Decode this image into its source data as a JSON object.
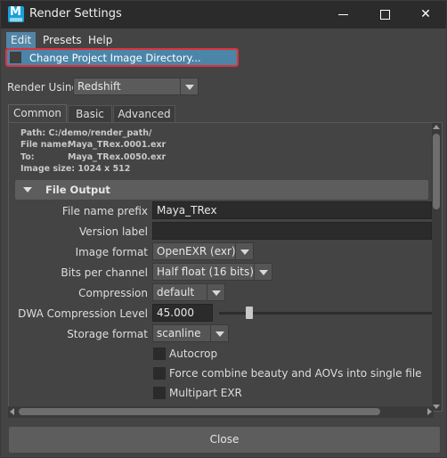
{
  "window": {
    "title": "Render Settings",
    "app_icon": "maya-app-icon"
  },
  "menu": {
    "items": [
      "Edit",
      "Presets",
      "Help"
    ],
    "open_item": {
      "label": "Change Project Image Directory...",
      "highlight_color": "#e0313a"
    }
  },
  "render_using": {
    "label": "Render Using",
    "value": "Redshift"
  },
  "tabs": [
    "Common",
    "Basic",
    "Advanced"
  ],
  "info": {
    "path": "Path: C:/demo/render_path/",
    "file_name_label": "File name:",
    "file_name": "Maya_TRex.0001.exr",
    "to_label": "To:",
    "to": "Maya_TRex.0050.exr",
    "image_size": "Image size: 1024 x 512"
  },
  "section": {
    "title": "File Output"
  },
  "fields": {
    "file_name_prefix": {
      "label": "File name prefix",
      "value": "Maya_TRex"
    },
    "version_label": {
      "label": "Version label",
      "value": ""
    },
    "image_format": {
      "label": "Image format",
      "value": "OpenEXR (exr)"
    },
    "bits_per_channel": {
      "label": "Bits per channel",
      "value": "Half float (16 bits)"
    },
    "compression": {
      "label": "Compression",
      "value": "default"
    },
    "dwa_compression_level": {
      "label": "DWA Compression Level",
      "value": "45.000"
    },
    "storage_format": {
      "label": "Storage format",
      "value": "scanline"
    }
  },
  "checkboxes": [
    {
      "label": "Autocrop",
      "checked": false
    },
    {
      "label": "Force combine beauty and AOVs into single file",
      "checked": false
    },
    {
      "label": "Multipart EXR",
      "checked": false
    }
  ],
  "footer": {
    "close_label": "Close"
  },
  "colors": {
    "window_bg": "#444444",
    "titlebar_bg": "#2b2b2b",
    "menu_highlight": "#5285a6",
    "field_bg": "#2b2b2b",
    "section_bg": "#5d5d5d"
  }
}
